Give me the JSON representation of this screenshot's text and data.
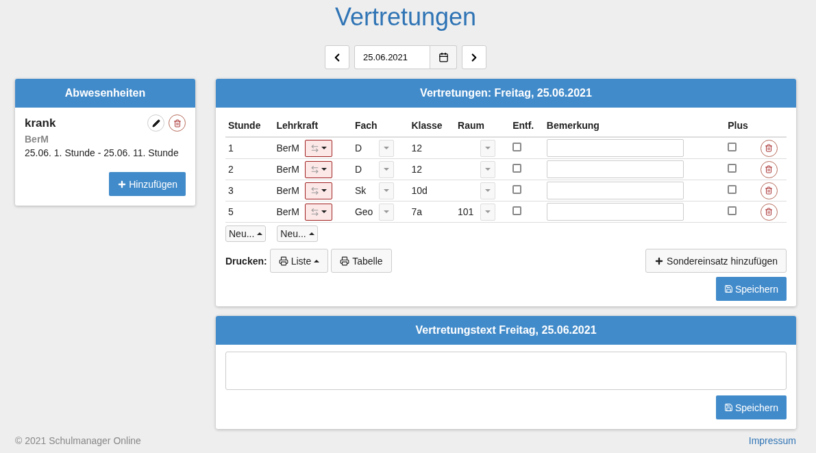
{
  "title": "Vertretungen",
  "date_nav": {
    "date": "25.06.2021"
  },
  "absences": {
    "title": "Abwesenheiten",
    "items": [
      {
        "reason": "krank",
        "teacher": "BerM",
        "period": "25.06. 1. Stunde - 25.06. 11. Stunde"
      }
    ],
    "add_button": "Hinzufügen"
  },
  "substitutions": {
    "title": "Vertretungen: Freitag, 25.06.2021",
    "columns": [
      "Stunde",
      "Lehrkraft",
      "Fach",
      "Klasse",
      "Raum",
      "Entf.",
      "Bemerkung",
      "Plus"
    ],
    "rows": [
      {
        "stunde": "1",
        "lehrkraft": "BerM",
        "fach": "D",
        "klasse": "12",
        "raum": "",
        "entfall": false,
        "plus": false
      },
      {
        "stunde": "2",
        "lehrkraft": "BerM",
        "fach": "D",
        "klasse": "12",
        "raum": "",
        "entfall": false,
        "plus": false
      },
      {
        "stunde": "3",
        "lehrkraft": "BerM",
        "fach": "Sk",
        "klasse": "10d",
        "raum": "",
        "entfall": false,
        "plus": false
      },
      {
        "stunde": "5",
        "lehrkraft": "BerM",
        "fach": "Geo",
        "klasse": "7a",
        "raum": "101",
        "entfall": false,
        "plus": false
      }
    ],
    "new_buttons": [
      "Neu...",
      "Neu..."
    ],
    "print_label": "Drucken:",
    "print_buttons": [
      "Liste",
      "Tabelle"
    ],
    "special_button": "Sondereinsatz hinzufügen",
    "save_button": "Speichern"
  },
  "text_panel": {
    "title": "Vertretungstext Freitag, 25.06.2021",
    "save_button": "Speichern"
  },
  "footer": {
    "copyright": "© 2021 Schulmanager Online",
    "link": "Impressum"
  }
}
